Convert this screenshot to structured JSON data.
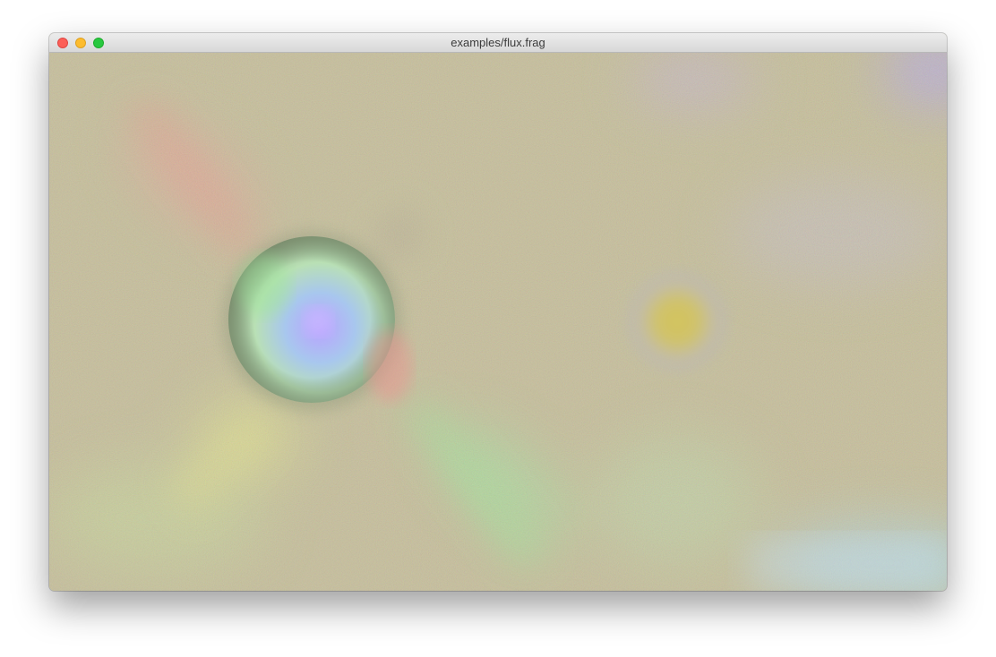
{
  "window": {
    "title": "examples/flux.frag"
  },
  "icons": {
    "close": "close-traffic-light-icon",
    "minimize": "minimize-traffic-light-icon",
    "zoom": "zoom-traffic-light-icon"
  },
  "colors": {
    "close": "#fc5f57",
    "minimize": "#fdbc2e",
    "zoom": "#28c840",
    "canvas_base": "#c6bf98"
  }
}
